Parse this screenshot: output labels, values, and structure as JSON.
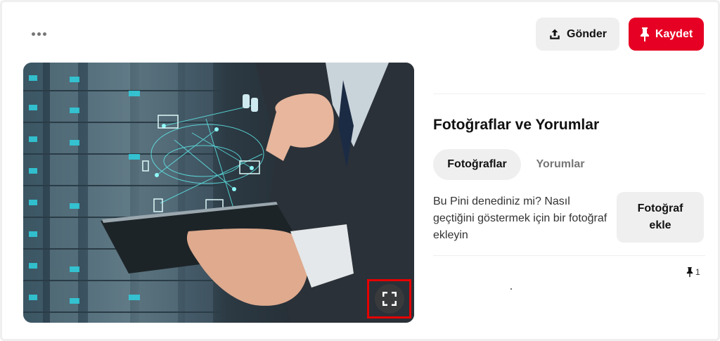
{
  "header": {
    "more_options_icon": "more-horizontal-icon",
    "share_label": "Gönder",
    "share_icon": "upload-icon",
    "save_label": "Kaydet",
    "save_icon": "pin-icon"
  },
  "image": {
    "expand_icon": "expand-icon"
  },
  "photos_comments": {
    "title": "Fotoğraflar ve Yorumlar",
    "tabs": [
      {
        "label": "Fotoğraflar",
        "active": true
      },
      {
        "label": "Yorumlar",
        "active": false
      }
    ],
    "prompt": "Bu Pini denediniz mi? Nasıl geçtiğini göstermek için bir fotoğraf ekleyin",
    "add_photo_label": "Fotoğraf ekle"
  },
  "stats": {
    "save_count": "1",
    "save_count_icon": "pin-icon"
  },
  "colors": {
    "save_button": "#e60023",
    "neutral_button": "#efefef",
    "highlight_box": "#e50000"
  }
}
